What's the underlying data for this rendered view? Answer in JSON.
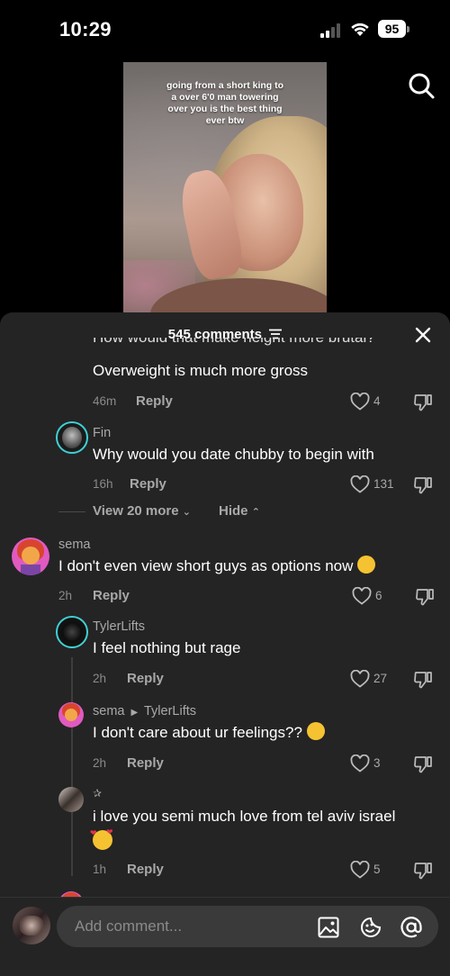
{
  "status": {
    "time": "10:29",
    "battery": "95"
  },
  "video": {
    "caption": [
      "going from a short king to",
      "a over 6'0 man towering",
      "over you is the best thing",
      "ever btw"
    ]
  },
  "comments_panel": {
    "count_label": "545 comments",
    "partial_top_text": "How would that make height more brutal?",
    "comments": [
      {
        "text": "Overweight is much more gross",
        "time": "46m",
        "reply": "Reply",
        "likes": "4"
      },
      {
        "user": "Fin",
        "text": "Why would you date chubby to begin with",
        "time": "16h",
        "reply": "Reply",
        "likes": "131"
      },
      {
        "user": "sema",
        "text": "I don't even view short guys as options now",
        "time": "2h",
        "reply": "Reply",
        "likes": "6"
      },
      {
        "user": "TylerLifts",
        "text": "I feel nothing but rage",
        "time": "2h",
        "reply": "Reply",
        "likes": "27"
      },
      {
        "user": "sema",
        "reply_to": "TylerLifts",
        "text": "I don't care about ur feelings??",
        "time": "2h",
        "reply": "Reply",
        "likes": "3"
      },
      {
        "user": "✰",
        "text": "i love you semi much love from tel aviv israel",
        "time": "1h",
        "reply": "Reply",
        "likes": "5"
      }
    ],
    "view_more": "View 20 more",
    "hide": "Hide"
  },
  "composer": {
    "placeholder": "Add comment..."
  },
  "icons": {
    "search": "search-icon",
    "close": "close-icon",
    "filter": "filter-icon",
    "like": "heart-icon",
    "dislike": "thumbs-down-icon",
    "image": "image-icon",
    "emoji": "emoji-icon",
    "mention": "at-icon"
  },
  "colors": {
    "sheet": "#242424",
    "accent_ring": "#3fd0d4",
    "muted": "#a9a9a9"
  }
}
